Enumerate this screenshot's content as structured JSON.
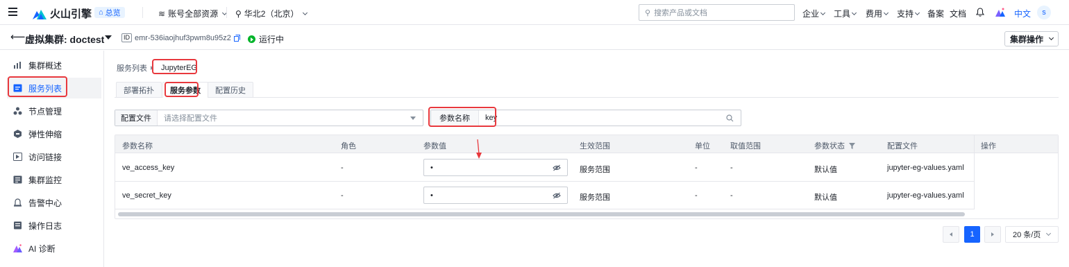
{
  "topnav": {
    "brand": "火山引擎",
    "home_label": "总览",
    "account_resource": "账号全部资源",
    "region": "华北2（北京）",
    "search_placeholder": "搜索产品或文档",
    "menu": [
      "企业",
      "工具",
      "费用",
      "支持",
      "备案",
      "文档"
    ],
    "language": "中文",
    "avatar_letter": "s"
  },
  "cluster": {
    "title": "虚拟集群:  doctest",
    "id_badge": "ID",
    "id": "emr-536iaojhuf3pwm8u95z2",
    "status": "运行中",
    "ops_label": "集群操作"
  },
  "sidebar": {
    "items": [
      {
        "label": "集群概述",
        "icon": "chart-icon"
      },
      {
        "label": "服务列表",
        "icon": "list-icon",
        "active": true
      },
      {
        "label": "节点管理",
        "icon": "nodes-icon"
      },
      {
        "label": "弹性伸缩",
        "icon": "scale-icon"
      },
      {
        "label": "访问链接",
        "icon": "link-icon"
      },
      {
        "label": "集群监控",
        "icon": "monitor-icon"
      },
      {
        "label": "告警中心",
        "icon": "alarm-icon"
      },
      {
        "label": "操作日志",
        "icon": "log-icon"
      },
      {
        "label": "AI 诊断",
        "icon": "ai-icon"
      }
    ]
  },
  "breadcrumb": {
    "parent": "服务列表",
    "current": "JupyterEG"
  },
  "tabs": [
    {
      "label": "部署拓扑"
    },
    {
      "label": "服务参数",
      "active": true
    },
    {
      "label": "配置历史"
    }
  ],
  "filters": {
    "config_file_label": "配置文件",
    "config_file_placeholder": "请选择配置文件",
    "param_name_label": "参数名称",
    "param_name_value": "key"
  },
  "table": {
    "columns": [
      "参数名称",
      "角色",
      "参数值",
      "生效范围",
      "单位",
      "取值范围",
      "参数状态",
      "配置文件",
      "操作"
    ],
    "rows": [
      {
        "name": "ve_access_key",
        "role": "-",
        "value": "•",
        "scope": "服务范围",
        "unit": "-",
        "range": "-",
        "status": "默认值",
        "file": "jupyter-eg-values.yaml"
      },
      {
        "name": "ve_secret_key",
        "role": "-",
        "value": "•",
        "scope": "服务范围",
        "unit": "-",
        "range": "-",
        "status": "默认值",
        "file": "jupyter-eg-values.yaml"
      }
    ]
  },
  "pagination": {
    "current_page": "1",
    "page_size": "20 条/页"
  }
}
